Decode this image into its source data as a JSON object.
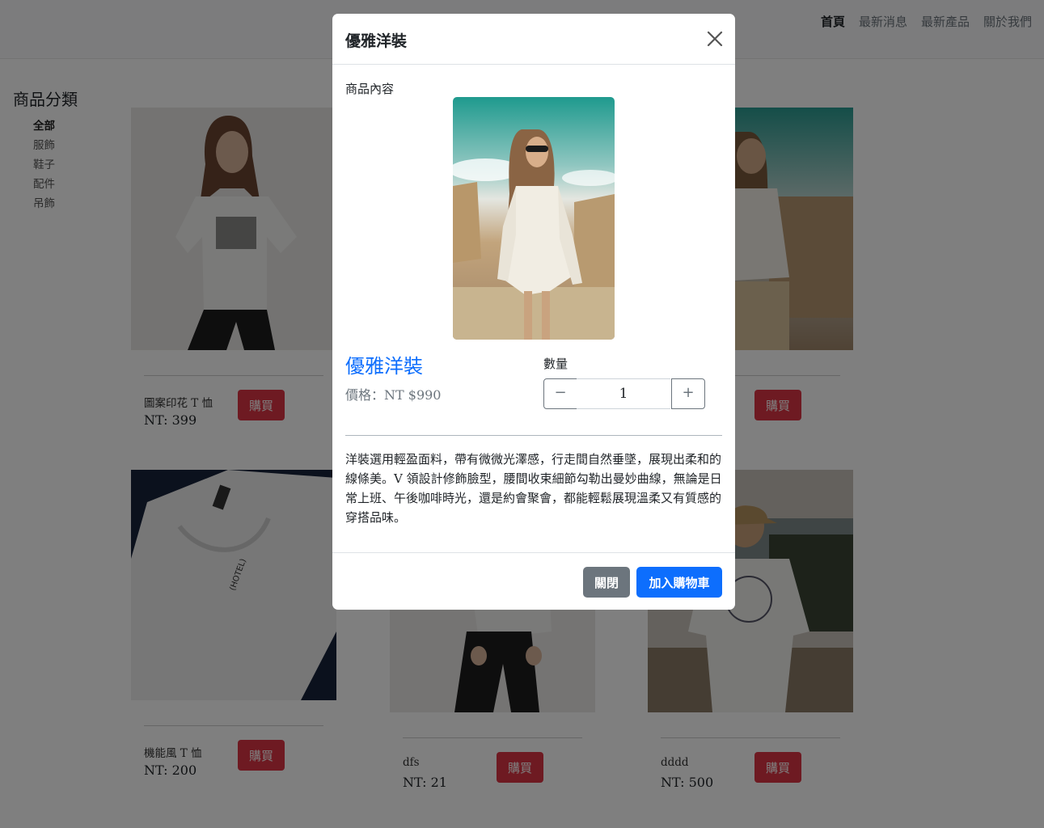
{
  "navbar": {
    "items": [
      "首頁",
      "最新消息",
      "最新產品",
      "關於我們"
    ]
  },
  "sidebar": {
    "title": "商品分類",
    "categories": [
      "全部",
      "服飾",
      "鞋子",
      "配件",
      "吊飾"
    ]
  },
  "products": [
    {
      "name": "圖案印花 T 恤",
      "price": "NT: 399",
      "buy_label": "購買"
    },
    {
      "name": "",
      "price": "",
      "buy_label": "購買"
    },
    {
      "name": "機能風 T 恤",
      "price": "NT: 200",
      "buy_label": "購買"
    },
    {
      "name": "dfs",
      "price": "NT: 21",
      "buy_label": "購買"
    },
    {
      "name": "dddd",
      "price": "NT: 500",
      "buy_label": "購買"
    }
  ],
  "modal": {
    "title": "優雅洋裝",
    "section_label": "商品內容",
    "product_name": "優雅洋裝",
    "price": "價格：NT $990",
    "quantity_label": "數量",
    "quantity_value": "1",
    "description": "洋裝選用輕盈面料，帶有微微光澤感，行走間自然垂墜，展現出柔和的線條美。V 領設計修飾臉型，腰間收束細節勾勒出曼妙曲線，無論是日常上班、午後咖啡時光，還是約會聚會，都能輕鬆展現溫柔又有質感的穿搭品味。",
    "close_button": "關閉",
    "add_to_cart_button": "加入購物車"
  }
}
